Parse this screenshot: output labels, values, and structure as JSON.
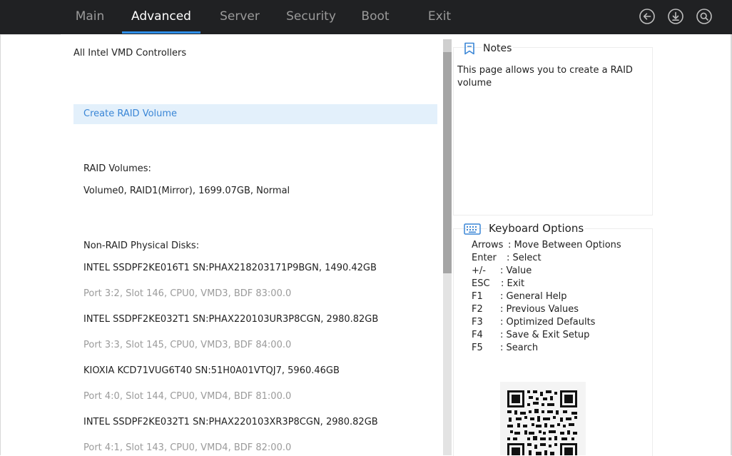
{
  "tabs": [
    {
      "label": "Main"
    },
    {
      "label": "Advanced"
    },
    {
      "label": "Server"
    },
    {
      "label": "Security"
    },
    {
      "label": "Boot"
    },
    {
      "label": "Exit"
    }
  ],
  "active_tab": "Advanced",
  "icons": {
    "back": "back-arrow-icon",
    "save": "download-icon",
    "search": "search-icon"
  },
  "main": {
    "section_title": "All Intel VMD Controllers",
    "create_raid": "Create RAID Volume",
    "raid_volumes_header": "RAID Volumes:",
    "raid_volumes": [
      "Volume0, RAID1(Mirror), 1699.07GB, Normal"
    ],
    "non_raid_header": "Non-RAID Physical Disks:",
    "disks": [
      {
        "name": "INTEL SSDPF2KE016T1 SN:PHAX218203171P9BGN, 1490.42GB",
        "port": "Port  3:2, Slot 146, CPU0, VMD3, BDF 83:00.0"
      },
      {
        "name": "INTEL SSDPF2KE032T1 SN:PHAX220103UR3P8CGN, 2980.82GB",
        "port": "Port  3:3, Slot 145, CPU0, VMD3, BDF 84:00.0"
      },
      {
        "name": "KIOXIA KCD71VUG6T40 SN:51H0A01VTQJ7, 5960.46GB",
        "port": "Port  4:0, Slot 144, CPU0, VMD4, BDF 81:00.0"
      },
      {
        "name": "INTEL SSDPF2KE032T1 SN:PHAX220103XR3P8CGN, 2980.82GB",
        "port": "Port  4:1, Slot 143, CPU0, VMD4, BDF 82:00.0"
      }
    ]
  },
  "notes": {
    "title": "Notes",
    "line1": "This page allows you to create a RAID",
    "line2": "volume"
  },
  "keyboard": {
    "title": "Keyboard Options",
    "rows": [
      {
        "key": "Arrows",
        "desc": ": Move Between Options"
      },
      {
        "key": "Enter",
        "desc": ": Select"
      },
      {
        "key": "+/-",
        "desc": ": Value"
      },
      {
        "key": "ESC",
        "desc": ": Exit"
      },
      {
        "key": "F1",
        "desc": ": General Help"
      },
      {
        "key": "F2",
        "desc": ": Previous Values"
      },
      {
        "key": "F3",
        "desc": ": Optimized Defaults"
      },
      {
        "key": "F4",
        "desc": ": Save & Exit Setup"
      },
      {
        "key": "F5",
        "desc": ": Search"
      }
    ]
  },
  "colors": {
    "topbar": "#202123",
    "accent": "#2f8ee8",
    "highlight_bg": "#e3f0fb",
    "highlight_text": "#3a86d6"
  }
}
